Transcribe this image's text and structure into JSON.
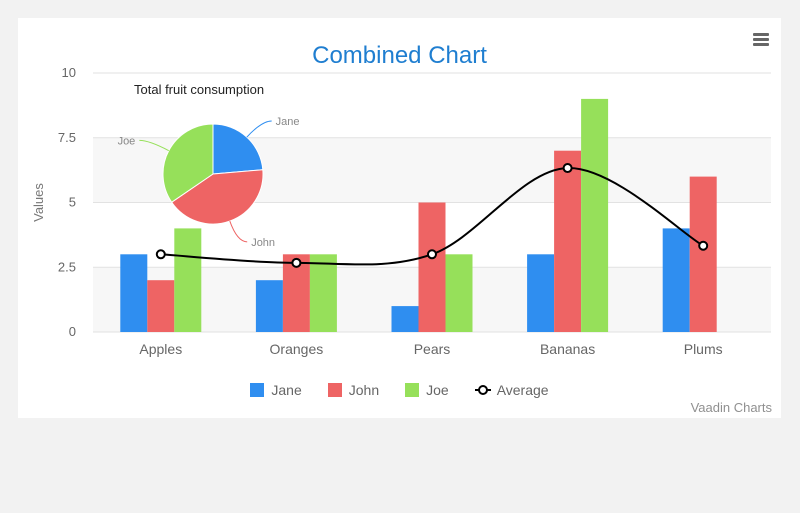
{
  "chart": {
    "title": "Combined Chart",
    "credits": "Vaadin Charts",
    "menu_icon": "hamburger-menu-icon"
  },
  "colors": {
    "Jane": "#2f8ef0",
    "John": "#ee6464",
    "Joe": "#96e05a",
    "Average": "#000000",
    "title": "#1f7ed0"
  },
  "legend": [
    {
      "name": "Jane",
      "type": "bar"
    },
    {
      "name": "John",
      "type": "bar"
    },
    {
      "name": "Joe",
      "type": "bar"
    },
    {
      "name": "Average",
      "type": "line"
    }
  ],
  "chart_data": [
    {
      "type": "bar",
      "categories": [
        "Apples",
        "Oranges",
        "Pears",
        "Bananas",
        "Plums"
      ],
      "series": [
        {
          "name": "Jane",
          "values": [
            3,
            2,
            1,
            3,
            4
          ]
        },
        {
          "name": "John",
          "values": [
            2,
            3,
            5,
            7,
            6
          ]
        },
        {
          "name": "Joe",
          "values": [
            4,
            3,
            3,
            9,
            0
          ]
        }
      ],
      "line_series": {
        "name": "Average",
        "values": [
          3,
          2.67,
          3,
          6.33,
          3.33
        ]
      },
      "ylabel": "Values",
      "ylim": [
        0,
        10
      ],
      "yticks": [
        "0",
        "2.5",
        "5",
        "7.5",
        "10"
      ],
      "grid": true,
      "legend_position": "bottom"
    },
    {
      "type": "pie",
      "title": "Total fruit consumption",
      "labels": [
        "Jane",
        "John",
        "Joe"
      ],
      "values": [
        13,
        23,
        19
      ]
    }
  ]
}
